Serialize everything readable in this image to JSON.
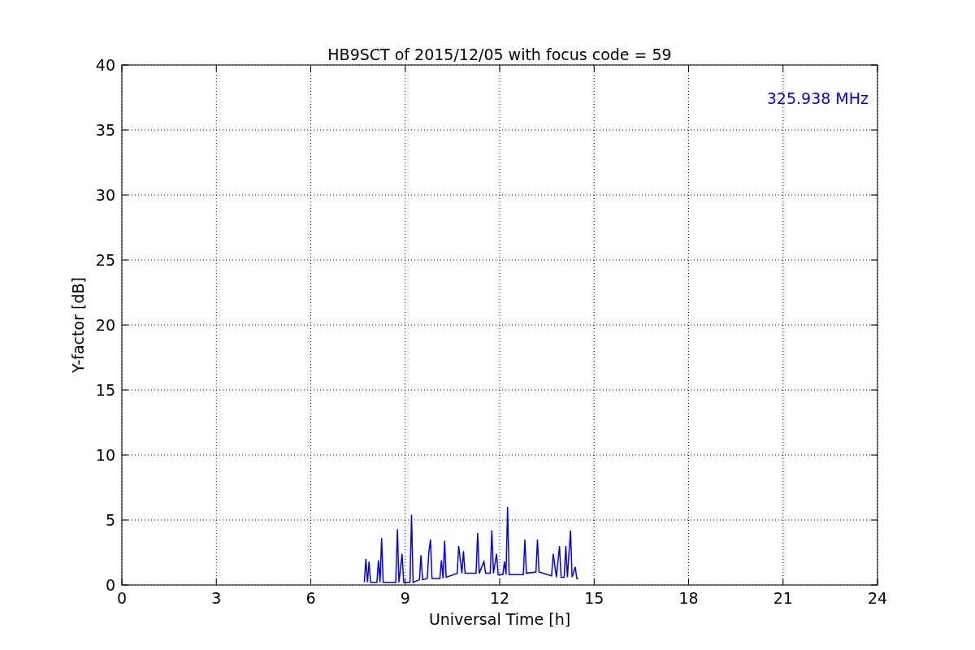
{
  "chart_data": {
    "type": "line",
    "title": "HB9SCT of 2015/12/05 with focus code = 59",
    "xlabel": "Universal Time [h]",
    "ylabel": "Y-factor [dB]",
    "xlim": [
      0,
      24
    ],
    "ylim": [
      0,
      40
    ],
    "xticks": [
      0,
      3,
      6,
      9,
      12,
      15,
      18,
      21,
      24
    ],
    "yticks": [
      0,
      5,
      10,
      15,
      20,
      25,
      30,
      35,
      40
    ],
    "grid": true,
    "x": [
      7.7,
      7.75,
      7.8,
      7.85,
      7.9,
      8.1,
      8.15,
      8.2,
      8.25,
      8.3,
      8.7,
      8.75,
      8.8,
      8.9,
      8.95,
      9.15,
      9.2,
      9.25,
      9.45,
      9.5,
      9.55,
      9.7,
      9.75,
      9.8,
      9.85,
      10.1,
      10.15,
      10.2,
      10.25,
      10.3,
      10.65,
      10.7,
      10.8,
      10.85,
      10.9,
      11.25,
      11.3,
      11.35,
      11.5,
      11.55,
      11.7,
      11.75,
      11.8,
      11.9,
      11.95,
      12.1,
      12.15,
      12.2,
      12.25,
      12.3,
      12.75,
      12.8,
      12.85,
      13.15,
      13.2,
      13.25,
      13.65,
      13.7,
      13.8,
      13.9,
      13.95,
      14.05,
      14.1,
      14.15,
      14.25,
      14.3,
      14.4,
      14.45,
      14.5
    ],
    "series": [
      {
        "name": "325.938 MHz",
        "color": "#0000ff",
        "values": [
          0.2,
          2.0,
          0.2,
          1.8,
          0.2,
          0.2,
          1.9,
          0.2,
          3.6,
          0.2,
          0.2,
          4.3,
          0.2,
          2.4,
          0.2,
          0.2,
          5.4,
          0.2,
          0.4,
          2.3,
          0.4,
          0.5,
          2.5,
          3.5,
          0.5,
          0.5,
          1.9,
          0.5,
          3.4,
          0.6,
          0.9,
          3.0,
          0.9,
          2.6,
          0.9,
          0.9,
          4.0,
          0.9,
          1.8,
          0.9,
          0.9,
          4.2,
          0.9,
          2.4,
          0.8,
          0.8,
          1.8,
          0.8,
          6.0,
          0.8,
          0.8,
          3.5,
          0.9,
          1.0,
          3.5,
          1.0,
          0.7,
          2.4,
          0.6,
          3.0,
          0.6,
          0.6,
          3.0,
          0.6,
          4.2,
          0.6,
          1.4,
          0.5,
          0.5
        ]
      }
    ]
  }
}
